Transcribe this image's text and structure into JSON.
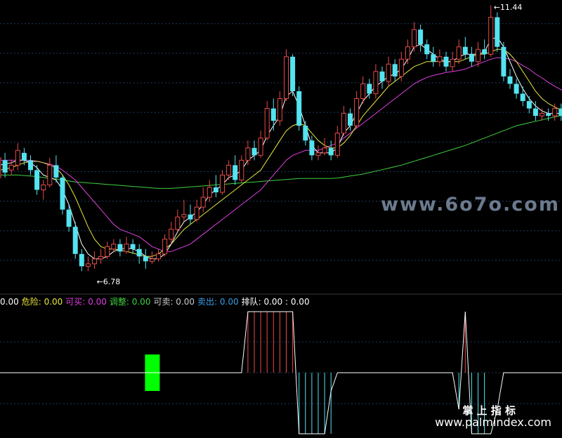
{
  "colors": {
    "background": "#000000",
    "grid": "#1e3a5f",
    "up_candle": "#e84a4a",
    "down_candle": "#54e3f0",
    "ma_white": "#ffffff",
    "ma_yellow": "#e8e83a",
    "ma_magenta": "#e040e0",
    "ma_green": "#40d040",
    "signal_green": "#00ff00",
    "watermark": "#6b7a8f"
  },
  "chart_data": [
    {
      "type": "candlestick",
      "title": "",
      "price_range": [
        5.6,
        11.55
      ],
      "grid": true,
      "grid_lines_y": [
        11.07,
        10.47,
        9.87,
        9.27,
        8.67,
        8.07,
        7.47,
        6.87,
        6.27
      ],
      "candles": [
        [
          7.95,
          8.35,
          8.5,
          7.8
        ],
        [
          8.3,
          8.05,
          8.45,
          7.95
        ],
        [
          8.1,
          8.2,
          8.3,
          8.0
        ],
        [
          8.2,
          8.5,
          8.65,
          8.1
        ],
        [
          8.45,
          8.3,
          8.55,
          8.2
        ],
        [
          8.3,
          8.1,
          8.4,
          8.0
        ],
        [
          8.1,
          7.7,
          8.2,
          7.6
        ],
        [
          7.7,
          7.8,
          7.9,
          7.5
        ],
        [
          7.8,
          8.2,
          8.35,
          7.75
        ],
        [
          8.2,
          7.95,
          8.4,
          7.85
        ],
        [
          7.95,
          7.3,
          8.0,
          7.2
        ],
        [
          7.3,
          6.95,
          7.4,
          6.85
        ],
        [
          6.95,
          6.4,
          7.05,
          6.3
        ],
        [
          6.4,
          6.15,
          6.5,
          6.05
        ],
        [
          6.15,
          6.2,
          6.35,
          6.05
        ],
        [
          6.2,
          6.3,
          6.45,
          6.1
        ],
        [
          6.3,
          6.35,
          6.5,
          6.2
        ],
        [
          6.35,
          6.55,
          6.65,
          6.3
        ],
        [
          6.5,
          6.6,
          6.7,
          6.45
        ],
        [
          6.6,
          6.45,
          6.7,
          6.35
        ],
        [
          6.45,
          6.6,
          6.75,
          6.4
        ],
        [
          6.6,
          6.5,
          6.7,
          6.4
        ],
        [
          6.5,
          6.35,
          6.6,
          6.2
        ],
        [
          6.35,
          6.25,
          6.5,
          6.1
        ],
        [
          6.25,
          6.3,
          6.45,
          6.2
        ],
        [
          6.3,
          6.4,
          6.5,
          6.25
        ],
        [
          6.4,
          6.7,
          6.8,
          6.35
        ],
        [
          6.7,
          6.9,
          7.05,
          6.6
        ],
        [
          6.9,
          7.15,
          7.3,
          6.85
        ],
        [
          7.15,
          7.2,
          7.5,
          7.05
        ],
        [
          7.2,
          7.1,
          7.4,
          7.0
        ],
        [
          7.1,
          7.35,
          7.5,
          7.05
        ],
        [
          7.35,
          7.55,
          7.75,
          7.25
        ],
        [
          7.55,
          7.75,
          7.9,
          7.45
        ],
        [
          7.75,
          7.65,
          8.0,
          7.55
        ],
        [
          7.65,
          8.0,
          8.1,
          7.6
        ],
        [
          8.0,
          8.2,
          8.3,
          7.9
        ],
        [
          8.2,
          7.9,
          8.4,
          7.8
        ],
        [
          7.9,
          8.3,
          8.4,
          7.85
        ],
        [
          8.3,
          8.55,
          8.7,
          8.2
        ],
        [
          8.55,
          8.4,
          8.7,
          8.3
        ],
        [
          8.4,
          8.75,
          8.9,
          8.35
        ],
        [
          8.75,
          9.35,
          9.5,
          8.7
        ],
        [
          9.35,
          9.1,
          9.55,
          8.9
        ],
        [
          9.1,
          9.55,
          9.7,
          9.0
        ],
        [
          9.55,
          10.4,
          10.55,
          9.5
        ],
        [
          10.4,
          9.7,
          10.45,
          9.6
        ],
        [
          9.7,
          9.0,
          9.8,
          8.9
        ],
        [
          9.0,
          8.7,
          9.1,
          8.6
        ],
        [
          8.7,
          8.4,
          8.8,
          8.3
        ],
        [
          8.4,
          8.45,
          8.6,
          8.3
        ],
        [
          8.45,
          8.55,
          8.75,
          8.4
        ],
        [
          8.55,
          8.4,
          8.7,
          8.3
        ],
        [
          8.4,
          8.85,
          9.0,
          8.35
        ],
        [
          8.85,
          9.25,
          9.4,
          8.8
        ],
        [
          9.25,
          9.0,
          9.35,
          8.9
        ],
        [
          9.0,
          9.55,
          9.7,
          8.95
        ],
        [
          9.55,
          9.85,
          10.0,
          9.45
        ],
        [
          9.85,
          9.65,
          9.95,
          9.55
        ],
        [
          9.65,
          10.1,
          10.25,
          9.55
        ],
        [
          10.1,
          9.9,
          10.2,
          9.75
        ],
        [
          9.9,
          10.25,
          10.4,
          9.8
        ],
        [
          10.25,
          10.0,
          10.35,
          9.9
        ],
        [
          10.0,
          10.35,
          10.5,
          9.9
        ],
        [
          10.35,
          10.6,
          10.75,
          10.25
        ],
        [
          10.6,
          10.95,
          11.1,
          10.5
        ],
        [
          10.95,
          10.65,
          11.05,
          10.5
        ],
        [
          10.65,
          10.45,
          10.75,
          10.35
        ],
        [
          10.45,
          10.3,
          10.6,
          10.2
        ],
        [
          10.3,
          10.4,
          10.55,
          10.2
        ],
        [
          10.4,
          10.2,
          10.5,
          10.1
        ],
        [
          10.2,
          10.35,
          10.5,
          10.1
        ],
        [
          10.35,
          10.6,
          10.75,
          10.25
        ],
        [
          10.6,
          10.45,
          10.8,
          10.35
        ],
        [
          10.45,
          10.3,
          10.6,
          10.2
        ],
        [
          10.3,
          10.55,
          10.7,
          10.2
        ],
        [
          10.55,
          10.45,
          10.75,
          10.35
        ],
        [
          10.45,
          11.2,
          11.44,
          10.4
        ],
        [
          11.2,
          10.6,
          11.3,
          10.5
        ],
        [
          10.6,
          10.0,
          10.7,
          9.9
        ],
        [
          10.0,
          9.85,
          10.15,
          9.75
        ],
        [
          9.85,
          9.65,
          9.95,
          9.55
        ],
        [
          9.65,
          9.5,
          9.8,
          9.4
        ],
        [
          9.5,
          9.35,
          9.6,
          9.25
        ],
        [
          9.35,
          9.2,
          9.5,
          9.1
        ],
        [
          9.2,
          9.25,
          9.35,
          9.1
        ],
        [
          9.25,
          9.2,
          9.35,
          9.1
        ],
        [
          9.2,
          9.35,
          9.45,
          9.1
        ],
        [
          9.35,
          9.2,
          9.45,
          9.1
        ],
        [
          9.2,
          9.15,
          9.3,
          9.05
        ]
      ],
      "ma_white": [
        8.2,
        8.22,
        8.25,
        8.3,
        8.3,
        8.25,
        8.15,
        8.0,
        7.95,
        7.9,
        7.7,
        7.4,
        7.0,
        6.6,
        6.4,
        6.3,
        6.3,
        6.35,
        6.45,
        6.5,
        6.52,
        6.5,
        6.45,
        6.35,
        6.3,
        6.3,
        6.4,
        6.6,
        6.85,
        7.05,
        7.15,
        7.25,
        7.4,
        7.6,
        7.7,
        7.8,
        7.95,
        8.0,
        8.1,
        8.3,
        8.4,
        8.5,
        8.8,
        9.0,
        9.2,
        9.6,
        9.7,
        9.4,
        9.0,
        8.6,
        8.45,
        8.45,
        8.45,
        8.55,
        8.85,
        9.0,
        9.25,
        9.5,
        9.65,
        9.8,
        9.9,
        10.0,
        10.05,
        10.15,
        10.35,
        10.6,
        10.65,
        10.55,
        10.45,
        10.35,
        10.3,
        10.3,
        10.4,
        10.45,
        10.45,
        10.45,
        10.5,
        10.75,
        10.8,
        10.6,
        10.3,
        10.0,
        9.75,
        9.55,
        9.4,
        9.3,
        9.25,
        9.25,
        9.25,
        9.2
      ],
      "ma_yellow": [
        8.1,
        8.12,
        8.15,
        8.2,
        8.25,
        8.27,
        8.28,
        8.25,
        8.2,
        8.15,
        8.0,
        7.8,
        7.55,
        7.25,
        6.95,
        6.7,
        6.55,
        6.5,
        6.5,
        6.48,
        6.45,
        6.42,
        6.38,
        6.35,
        6.35,
        6.4,
        6.5,
        6.6,
        6.75,
        6.9,
        7.0,
        7.1,
        7.2,
        7.3,
        7.4,
        7.5,
        7.6,
        7.7,
        7.8,
        7.9,
        8.0,
        8.1,
        8.3,
        8.5,
        8.7,
        8.9,
        9.0,
        9.05,
        9.0,
        8.85,
        8.7,
        8.6,
        8.55,
        8.55,
        8.65,
        8.8,
        9.0,
        9.2,
        9.35,
        9.5,
        9.65,
        9.8,
        9.9,
        10.0,
        10.1,
        10.2,
        10.25,
        10.3,
        10.3,
        10.3,
        10.3,
        10.3,
        10.3,
        10.35,
        10.4,
        10.45,
        10.45,
        10.5,
        10.55,
        10.55,
        10.45,
        10.3,
        10.1,
        9.9,
        9.7,
        9.55,
        9.45,
        9.38,
        9.32,
        9.28
      ],
      "ma_magenta": [
        8.3,
        8.3,
        8.3,
        8.3,
        8.3,
        8.3,
        8.28,
        8.25,
        8.22,
        8.18,
        8.1,
        8.0,
        7.9,
        7.75,
        7.6,
        7.45,
        7.3,
        7.15,
        7.0,
        6.9,
        6.85,
        6.8,
        6.75,
        6.65,
        6.55,
        6.5,
        6.45,
        6.45,
        6.5,
        6.55,
        6.6,
        6.7,
        6.8,
        6.9,
        7.0,
        7.1,
        7.2,
        7.3,
        7.4,
        7.5,
        7.6,
        7.7,
        7.85,
        8.0,
        8.15,
        8.3,
        8.4,
        8.45,
        8.5,
        8.5,
        8.5,
        8.55,
        8.6,
        8.65,
        8.75,
        8.85,
        8.95,
        9.05,
        9.15,
        9.25,
        9.35,
        9.45,
        9.55,
        9.65,
        9.75,
        9.85,
        9.92,
        9.98,
        10.02,
        10.05,
        10.08,
        10.1,
        10.12,
        10.15,
        10.2,
        10.25,
        10.3,
        10.35,
        10.38,
        10.38,
        10.35,
        10.3,
        10.22,
        10.15,
        10.05,
        9.97,
        9.88,
        9.8,
        9.73,
        9.68
      ],
      "ma_green": [
        8.0,
        8.0,
        8.0,
        8.0,
        7.99,
        7.98,
        7.97,
        7.95,
        7.93,
        7.92,
        7.9,
        7.88,
        7.86,
        7.85,
        7.84,
        7.83,
        7.82,
        7.81,
        7.8,
        7.79,
        7.78,
        7.77,
        7.76,
        7.75,
        7.74,
        7.73,
        7.73,
        7.73,
        7.74,
        7.75,
        7.76,
        7.77,
        7.78,
        7.79,
        7.8,
        7.81,
        7.82,
        7.83,
        7.84,
        7.85,
        7.86,
        7.87,
        7.88,
        7.89,
        7.9,
        7.91,
        7.92,
        7.93,
        7.93,
        7.93,
        7.93,
        7.93,
        7.93,
        7.94,
        7.96,
        7.98,
        8.0,
        8.02,
        8.05,
        8.08,
        8.11,
        8.14,
        8.17,
        8.2,
        8.24,
        8.28,
        8.32,
        8.36,
        8.4,
        8.44,
        8.48,
        8.52,
        8.56,
        8.6,
        8.65,
        8.7,
        8.75,
        8.8,
        8.85,
        8.9,
        8.95,
        9.0,
        9.03,
        9.06,
        9.09,
        9.12,
        9.15,
        9.18,
        9.21,
        9.24
      ],
      "annotations": {
        "low_label": "←6.78",
        "high_label": "←11.44",
        "low_index": 15,
        "high_index": 77
      }
    },
    {
      "type": "signal",
      "title": "",
      "legend": [
        {
          "label": "0.00",
          "color": "#ffffff"
        },
        {
          "label": "危险: 0.00",
          "color": "#e8e83a"
        },
        {
          "label": "可买: 0.00",
          "color": "#e040e0"
        },
        {
          "label": "调整: 0.00",
          "color": "#40d040"
        },
        {
          "label": "可卖: 0.00",
          "color": "#cccccc"
        },
        {
          "label": "卖出: 0.00",
          "color": "#3a9ee8"
        },
        {
          "label": "排队: 0.00 : 0.00",
          "color": "#ffffff"
        }
      ],
      "baseline": 0,
      "y_range": [
        -1,
        1
      ],
      "step_line": [
        0,
        0,
        0,
        0,
        0,
        0,
        0,
        0,
        0,
        0,
        0,
        0,
        0,
        0,
        0,
        0,
        0,
        0,
        0,
        0,
        0,
        0,
        0,
        0,
        0,
        0,
        0,
        0,
        0,
        0,
        0,
        0,
        0,
        0,
        0,
        0,
        0,
        0,
        0,
        1,
        1,
        1,
        1,
        1,
        1,
        1,
        1,
        -1,
        -1,
        -1,
        -1,
        -1,
        -0.3,
        0,
        0,
        0,
        0,
        0,
        0,
        0,
        0,
        0,
        0,
        0,
        0,
        0,
        0,
        0,
        0,
        0,
        0,
        0,
        -0.6,
        1,
        -1,
        -1,
        -1,
        -1,
        -0.6,
        0,
        0,
        0,
        0,
        0,
        0,
        0,
        0,
        0,
        0,
        0
      ],
      "green_block_index": 24,
      "red_bars_range": [
        39,
        46
      ],
      "cyan_bars_range": [
        47,
        52
      ]
    }
  ],
  "watermarks": {
    "center": "www.6o7o.com",
    "bottom_cn": "掌 上 指 标",
    "bottom_url": "www.palmindex.com"
  }
}
